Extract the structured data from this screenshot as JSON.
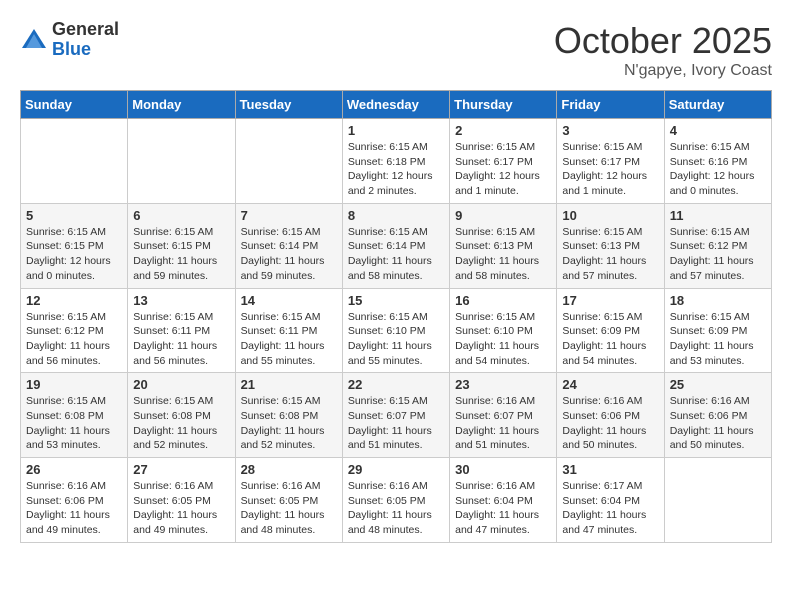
{
  "logo": {
    "general": "General",
    "blue": "Blue"
  },
  "title": "October 2025",
  "location": "N'gapye, Ivory Coast",
  "days_header": [
    "Sunday",
    "Monday",
    "Tuesday",
    "Wednesday",
    "Thursday",
    "Friday",
    "Saturday"
  ],
  "weeks": [
    [
      {
        "num": "",
        "info": ""
      },
      {
        "num": "",
        "info": ""
      },
      {
        "num": "",
        "info": ""
      },
      {
        "num": "1",
        "info": "Sunrise: 6:15 AM\nSunset: 6:18 PM\nDaylight: 12 hours\nand 2 minutes."
      },
      {
        "num": "2",
        "info": "Sunrise: 6:15 AM\nSunset: 6:17 PM\nDaylight: 12 hours\nand 1 minute."
      },
      {
        "num": "3",
        "info": "Sunrise: 6:15 AM\nSunset: 6:17 PM\nDaylight: 12 hours\nand 1 minute."
      },
      {
        "num": "4",
        "info": "Sunrise: 6:15 AM\nSunset: 6:16 PM\nDaylight: 12 hours\nand 0 minutes."
      }
    ],
    [
      {
        "num": "5",
        "info": "Sunrise: 6:15 AM\nSunset: 6:15 PM\nDaylight: 12 hours\nand 0 minutes."
      },
      {
        "num": "6",
        "info": "Sunrise: 6:15 AM\nSunset: 6:15 PM\nDaylight: 11 hours\nand 59 minutes."
      },
      {
        "num": "7",
        "info": "Sunrise: 6:15 AM\nSunset: 6:14 PM\nDaylight: 11 hours\nand 59 minutes."
      },
      {
        "num": "8",
        "info": "Sunrise: 6:15 AM\nSunset: 6:14 PM\nDaylight: 11 hours\nand 58 minutes."
      },
      {
        "num": "9",
        "info": "Sunrise: 6:15 AM\nSunset: 6:13 PM\nDaylight: 11 hours\nand 58 minutes."
      },
      {
        "num": "10",
        "info": "Sunrise: 6:15 AM\nSunset: 6:13 PM\nDaylight: 11 hours\nand 57 minutes."
      },
      {
        "num": "11",
        "info": "Sunrise: 6:15 AM\nSunset: 6:12 PM\nDaylight: 11 hours\nand 57 minutes."
      }
    ],
    [
      {
        "num": "12",
        "info": "Sunrise: 6:15 AM\nSunset: 6:12 PM\nDaylight: 11 hours\nand 56 minutes."
      },
      {
        "num": "13",
        "info": "Sunrise: 6:15 AM\nSunset: 6:11 PM\nDaylight: 11 hours\nand 56 minutes."
      },
      {
        "num": "14",
        "info": "Sunrise: 6:15 AM\nSunset: 6:11 PM\nDaylight: 11 hours\nand 55 minutes."
      },
      {
        "num": "15",
        "info": "Sunrise: 6:15 AM\nSunset: 6:10 PM\nDaylight: 11 hours\nand 55 minutes."
      },
      {
        "num": "16",
        "info": "Sunrise: 6:15 AM\nSunset: 6:10 PM\nDaylight: 11 hours\nand 54 minutes."
      },
      {
        "num": "17",
        "info": "Sunrise: 6:15 AM\nSunset: 6:09 PM\nDaylight: 11 hours\nand 54 minutes."
      },
      {
        "num": "18",
        "info": "Sunrise: 6:15 AM\nSunset: 6:09 PM\nDaylight: 11 hours\nand 53 minutes."
      }
    ],
    [
      {
        "num": "19",
        "info": "Sunrise: 6:15 AM\nSunset: 6:08 PM\nDaylight: 11 hours\nand 53 minutes."
      },
      {
        "num": "20",
        "info": "Sunrise: 6:15 AM\nSunset: 6:08 PM\nDaylight: 11 hours\nand 52 minutes."
      },
      {
        "num": "21",
        "info": "Sunrise: 6:15 AM\nSunset: 6:08 PM\nDaylight: 11 hours\nand 52 minutes."
      },
      {
        "num": "22",
        "info": "Sunrise: 6:15 AM\nSunset: 6:07 PM\nDaylight: 11 hours\nand 51 minutes."
      },
      {
        "num": "23",
        "info": "Sunrise: 6:16 AM\nSunset: 6:07 PM\nDaylight: 11 hours\nand 51 minutes."
      },
      {
        "num": "24",
        "info": "Sunrise: 6:16 AM\nSunset: 6:06 PM\nDaylight: 11 hours\nand 50 minutes."
      },
      {
        "num": "25",
        "info": "Sunrise: 6:16 AM\nSunset: 6:06 PM\nDaylight: 11 hours\nand 50 minutes."
      }
    ],
    [
      {
        "num": "26",
        "info": "Sunrise: 6:16 AM\nSunset: 6:06 PM\nDaylight: 11 hours\nand 49 minutes."
      },
      {
        "num": "27",
        "info": "Sunrise: 6:16 AM\nSunset: 6:05 PM\nDaylight: 11 hours\nand 49 minutes."
      },
      {
        "num": "28",
        "info": "Sunrise: 6:16 AM\nSunset: 6:05 PM\nDaylight: 11 hours\nand 48 minutes."
      },
      {
        "num": "29",
        "info": "Sunrise: 6:16 AM\nSunset: 6:05 PM\nDaylight: 11 hours\nand 48 minutes."
      },
      {
        "num": "30",
        "info": "Sunrise: 6:16 AM\nSunset: 6:04 PM\nDaylight: 11 hours\nand 47 minutes."
      },
      {
        "num": "31",
        "info": "Sunrise: 6:17 AM\nSunset: 6:04 PM\nDaylight: 11 hours\nand 47 minutes."
      },
      {
        "num": "",
        "info": ""
      }
    ]
  ]
}
